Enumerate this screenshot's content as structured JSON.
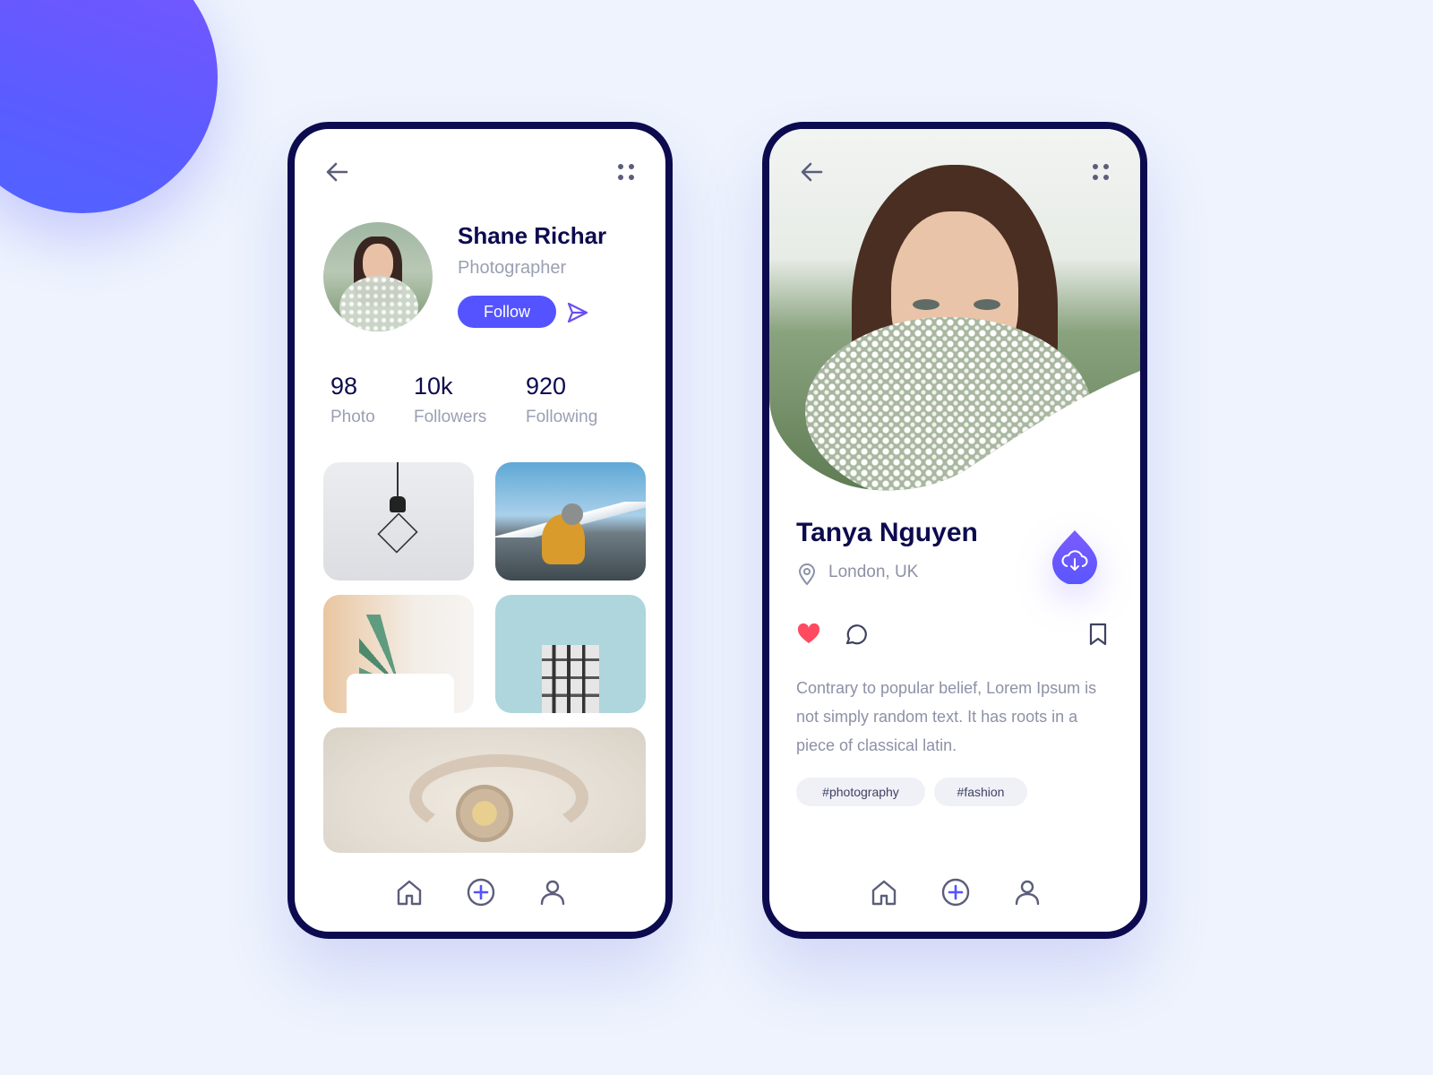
{
  "colors": {
    "accent": "#5453ff",
    "navy": "#0d0b4f",
    "muted": "#9a9fb3",
    "heart": "#ff4a5f"
  },
  "left": {
    "profile": {
      "name": "Shane Richar",
      "role": "Photographer",
      "follow_label": "Follow"
    },
    "stats": [
      {
        "value": "98",
        "label": "Photo"
      },
      {
        "value": "10k",
        "label": "Followers"
      },
      {
        "value": "920",
        "label": "Following"
      }
    ],
    "icons": [
      "back-arrow-icon",
      "grid-dots-icon",
      "send-icon",
      "home-icon",
      "add-circle-icon",
      "user-icon"
    ]
  },
  "right": {
    "name": "Tanya Nguyen",
    "location": "London, UK",
    "description": "Contrary to popular belief, Lorem Ipsum is not simply random text. It has roots in a piece of classical latin.",
    "tags": [
      "#photography",
      "#fashion"
    ],
    "icons": [
      "back-arrow-icon",
      "grid-dots-icon",
      "location-pin-icon",
      "download-cloud-icon",
      "heart-icon",
      "comment-icon",
      "bookmark-icon"
    ]
  }
}
